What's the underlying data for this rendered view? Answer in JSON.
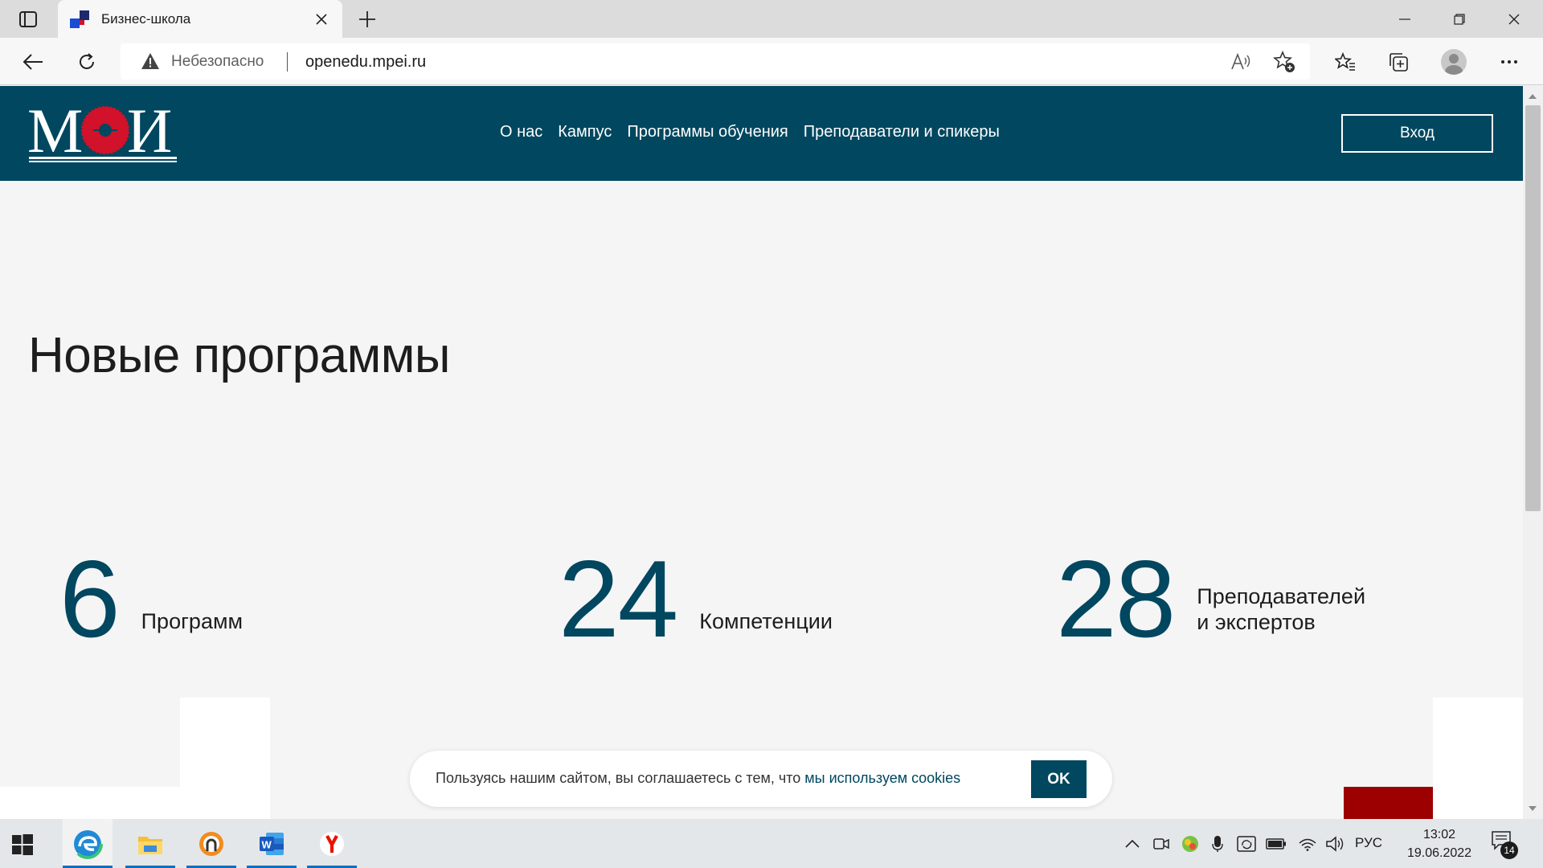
{
  "browser": {
    "tab_title": "Бизнес-школа",
    "insecure_label": "Небезопасно",
    "url": "openedu.mpei.ru"
  },
  "site": {
    "logo_text": "МЭИ",
    "nav": [
      "О нас",
      "Кампус",
      "Программы обучения",
      "Преподаватели и спикеры"
    ],
    "login_label": "Вход",
    "heading": "Новые программы",
    "stats": [
      {
        "value": "6",
        "label_line1": "Программ",
        "label_line2": ""
      },
      {
        "value": "24",
        "label_line1": "Компетенции",
        "label_line2": ""
      },
      {
        "value": "28",
        "label_line1": "Преподавателей",
        "label_line2": "и экспертов"
      }
    ],
    "cookie": {
      "text": "Пользуясь нашим сайтом, вы соглашаетесь с тем, что ",
      "link": "мы используем cookies",
      "ok_label": "OK"
    },
    "colors": {
      "brand": "#00475f",
      "accent_red": "#9c0000",
      "logo_red": "#d2112a"
    }
  },
  "taskbar": {
    "apps": [
      "edge-icon",
      "file-explorer-icon",
      "app-circle-icon",
      "word-icon",
      "yandex-browser-icon"
    ],
    "language": "РУС",
    "time": "13:02",
    "date": "19.06.2022",
    "notification_count": "14"
  }
}
